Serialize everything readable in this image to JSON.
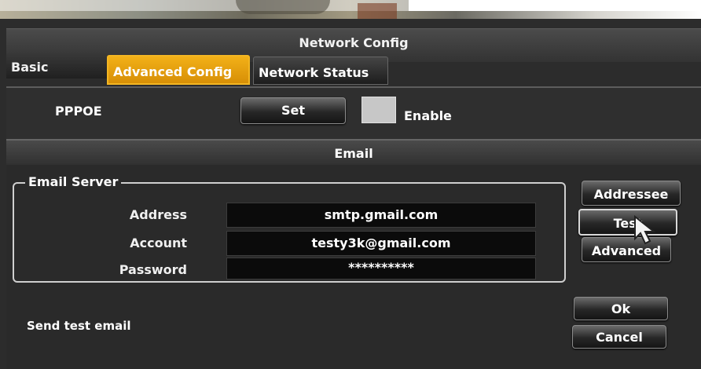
{
  "window": {
    "title": "Network Config"
  },
  "tabs": [
    {
      "label": "Basic",
      "active": false
    },
    {
      "label": "Advanced Config",
      "active": true
    },
    {
      "label": "Network Status",
      "active": false
    }
  ],
  "pppoe": {
    "label": "PPPOE",
    "set_button": "Set",
    "enable_label": "Enable",
    "enabled": false
  },
  "email": {
    "section_title": "Email",
    "server_group_label": "Email Server",
    "fields": [
      {
        "label": "Address",
        "value": "smtp.gmail.com"
      },
      {
        "label": "Account",
        "value": "testy3k@gmail.com"
      },
      {
        "label": "Password",
        "value": "**********"
      }
    ],
    "send_test_label": "Send test email"
  },
  "buttons": {
    "addressee": "Addressee",
    "test": "Test",
    "advanced": "Advanced",
    "ok": "Ok",
    "cancel": "Cancel"
  },
  "colors": {
    "active_tab": "#e9a311",
    "background": "#2c2c2c"
  },
  "icons": {
    "cursor": "mouse-pointer-icon"
  }
}
